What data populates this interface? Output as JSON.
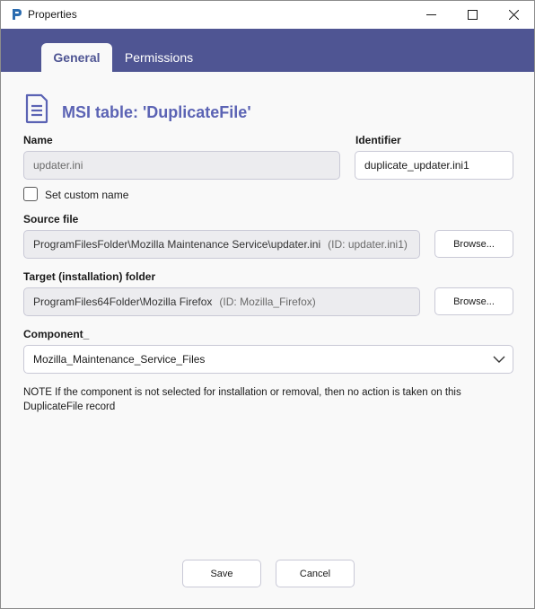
{
  "window": {
    "title": "Properties",
    "icon": "app-logo-icon",
    "controls": [
      "minimize-icon",
      "maximize-icon",
      "close-icon"
    ]
  },
  "tabs": [
    {
      "label": "General",
      "selected": true
    },
    {
      "label": "Permissions",
      "selected": false
    }
  ],
  "header": {
    "icon": "document-icon",
    "title": "MSI table: 'DuplicateFile'"
  },
  "form": {
    "name": {
      "label": "Name",
      "value": "updater.ini",
      "disabled": true
    },
    "identifier": {
      "label": "Identifier",
      "value": "duplicate_updater.ini1"
    },
    "custom_name": {
      "label": "Set custom name",
      "checked": false
    },
    "source_file": {
      "label": "Source file",
      "value": "ProgramFilesFolder\\Mozilla Maintenance Service\\updater.ini",
      "id_text": "(ID: updater.ini1)",
      "browse_label": "Browse..."
    },
    "target_folder": {
      "label": "Target (installation) folder",
      "value": "ProgramFiles64Folder\\Mozilla Firefox",
      "id_text": "(ID: Mozilla_Firefox)",
      "browse_label": "Browse..."
    },
    "component": {
      "label": "Component_",
      "value": "Mozilla_Maintenance_Service_Files"
    },
    "note": "NOTE If the component is not selected for installation or removal, then no action is taken on this DuplicateFile record"
  },
  "footer": {
    "save_label": "Save",
    "cancel_label": "Cancel"
  },
  "colors": {
    "accent": "#4f5593",
    "title": "#5b63b4",
    "border": "#c9c9d6",
    "disabled_field": "#ececef"
  }
}
